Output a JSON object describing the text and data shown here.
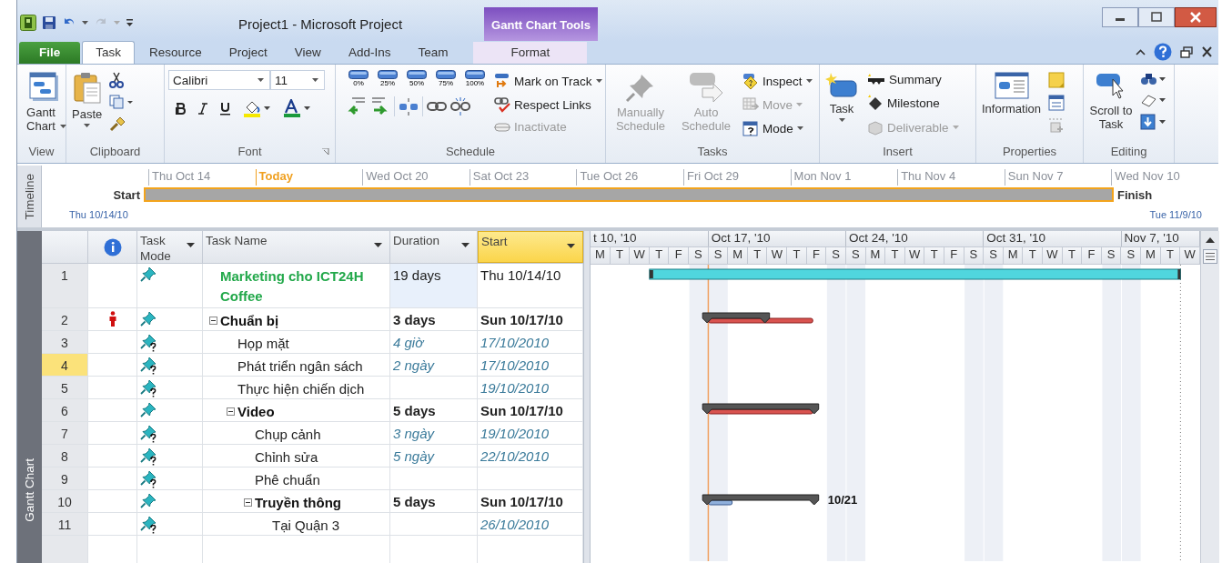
{
  "window": {
    "title": "Project1  -  Microsoft Project"
  },
  "contextual_tab": {
    "title": "Gantt Chart Tools"
  },
  "tabs": [
    {
      "label": "File",
      "kind": "file",
      "selected": false
    },
    {
      "label": "Task",
      "kind": "normal",
      "selected": true
    },
    {
      "label": "Resource",
      "kind": "normal",
      "selected": false
    },
    {
      "label": "Project",
      "kind": "normal",
      "selected": false
    },
    {
      "label": "View",
      "kind": "normal",
      "selected": false
    },
    {
      "label": "Add-Ins",
      "kind": "normal",
      "selected": false
    },
    {
      "label": "Team",
      "kind": "normal",
      "selected": false
    },
    {
      "label": "Format",
      "kind": "contextual",
      "selected": false
    }
  ],
  "ribbon": {
    "groups": [
      {
        "label": "View",
        "buttons": [
          {
            "label": "Gantt Chart",
            "disabled": false
          }
        ]
      },
      {
        "label": "Clipboard",
        "buttons": [
          {
            "label": "Paste",
            "disabled": false
          }
        ]
      },
      {
        "label": "Font",
        "font_name": "Calibri",
        "font_size": "11"
      },
      {
        "label": "Schedule",
        "percent_buttons": [
          "0%",
          "25%",
          "50%",
          "75%",
          "100%"
        ],
        "buttons": [
          {
            "label": "Mark on Track",
            "disabled": false
          },
          {
            "label": "Respect Links",
            "disabled": false
          },
          {
            "label": "Inactivate",
            "disabled": true
          }
        ]
      },
      {
        "label": "Tasks",
        "buttons": [
          {
            "label": "Manually Schedule",
            "disabled": true
          },
          {
            "label": "Auto Schedule",
            "disabled": true
          },
          {
            "label": "Inspect",
            "disabled": false
          },
          {
            "label": "Move",
            "disabled": true
          },
          {
            "label": "Mode",
            "disabled": false
          }
        ]
      },
      {
        "label": "Insert",
        "buttons": [
          {
            "label": "Task",
            "disabled": false
          },
          {
            "label": "Summary",
            "disabled": false
          },
          {
            "label": "Milestone",
            "disabled": false
          },
          {
            "label": "Deliverable",
            "disabled": true
          }
        ]
      },
      {
        "label": "Properties",
        "buttons": [
          {
            "label": "Information",
            "disabled": false
          }
        ]
      },
      {
        "label": "Editing",
        "buttons": [
          {
            "label": "Scroll to Task",
            "disabled": false
          }
        ]
      }
    ]
  },
  "timeline": {
    "label": "Timeline",
    "ticks": [
      {
        "label": "Thu Oct 14",
        "kind": "date"
      },
      {
        "label": "Today",
        "kind": "today"
      },
      {
        "label": "Wed Oct 20",
        "kind": "date"
      },
      {
        "label": "Sat Oct 23",
        "kind": "date"
      },
      {
        "label": "Tue Oct 26",
        "kind": "date"
      },
      {
        "label": "Fri Oct 29",
        "kind": "date"
      },
      {
        "label": "Mon Nov 1",
        "kind": "date"
      },
      {
        "label": "Thu Nov 4",
        "kind": "date"
      },
      {
        "label": "Sun Nov 7",
        "kind": "date"
      },
      {
        "label": "Wed Nov 10",
        "kind": "date"
      }
    ],
    "start_label": "Start",
    "start_date": "Thu 10/14/10",
    "finish_label": "Finish",
    "finish_date": "Tue 11/9/10"
  },
  "view_label": "Gantt Chart",
  "table": {
    "columns": [
      {
        "kind": "indicators",
        "selected": false
      },
      {
        "label": "Task Mode",
        "kind": "text",
        "selected": false
      },
      {
        "label": "Task Name",
        "kind": "text",
        "selected": false
      },
      {
        "label": "Duration",
        "kind": "text",
        "selected": false
      },
      {
        "label": "Start",
        "kind": "text",
        "selected": true
      }
    ],
    "rows": [
      {
        "id": "1",
        "name": "Marketing cho ICT24H Coffee",
        "kind": "project",
        "flagged": false,
        "estimated": false,
        "duration": "19 days",
        "start": "Thu 10/14/10",
        "selected": false,
        "duration_focused": true
      },
      {
        "id": "2",
        "name": "Chuẩn bị",
        "kind": "summary",
        "expanded": true,
        "flagged": true,
        "estimated": false,
        "duration": "3 days",
        "start": "Sun 10/17/10",
        "selected": false,
        "duration_focused": false,
        "children": [
          {
            "id": "3",
            "name": "Họp mặt",
            "kind": "task",
            "flagged": false,
            "estimated": true,
            "duration": "4 giờ",
            "start": "17/10/2010",
            "selected": false,
            "duration_focused": false
          },
          {
            "id": "4",
            "name": "Phát triển ngân sách",
            "kind": "task",
            "flagged": false,
            "estimated": true,
            "duration": "2 ngày",
            "start": "17/10/2010",
            "selected": true,
            "duration_focused": false
          },
          {
            "id": "5",
            "name": "Thực hiện chiến dịch",
            "kind": "task",
            "flagged": false,
            "estimated": true,
            "start": "19/10/2010",
            "selected": false,
            "duration_focused": false
          },
          {
            "id": "6",
            "name": "Video",
            "kind": "summary",
            "expanded": true,
            "flagged": false,
            "estimated": false,
            "duration": "5 days",
            "start": "Sun 10/17/10",
            "selected": false,
            "duration_focused": false,
            "children": [
              {
                "id": "7",
                "name": "Chụp cảnh",
                "kind": "task",
                "flagged": false,
                "estimated": true,
                "duration": "3 ngày",
                "start": "19/10/2010",
                "selected": false,
                "duration_focused": false
              },
              {
                "id": "8",
                "name": "Chỉnh sửa",
                "kind": "task",
                "flagged": false,
                "estimated": true,
                "duration": "5 ngày",
                "start": "22/10/2010",
                "selected": false,
                "duration_focused": false
              },
              {
                "id": "9",
                "name": "Phê chuẩn",
                "kind": "task",
                "flagged": false,
                "estimated": true,
                "selected": false,
                "duration_focused": false
              },
              {
                "id": "10",
                "name": "Truyền thông",
                "kind": "summary",
                "expanded": true,
                "flagged": false,
                "estimated": false,
                "duration": "5 days",
                "start": "Sun 10/17/10",
                "selected": false,
                "duration_focused": false,
                "bar_label": "10/21",
                "children": [
                  {
                    "id": "11",
                    "name": "Tại Quận 3",
                    "kind": "task",
                    "flagged": false,
                    "estimated": true,
                    "start": "26/10/2010",
                    "selected": false,
                    "duration_focused": false
                  }
                ]
              }
            ]
          }
        ]
      }
    ]
  },
  "gantt": {
    "weeks": [
      {
        "label": "t 10, '10",
        "days": [
          "M",
          "T",
          "W",
          "T",
          "F",
          "S"
        ]
      },
      {
        "label": "Oct 17, '10",
        "days": [
          "S",
          "M",
          "T",
          "W",
          "T",
          "F",
          "S"
        ]
      },
      {
        "label": "Oct 24, '10",
        "days": [
          "S",
          "M",
          "T",
          "W",
          "T",
          "F",
          "S"
        ]
      },
      {
        "label": "Oct 31, '10",
        "days": [
          "S",
          "M",
          "T",
          "W",
          "T",
          "F",
          "S"
        ]
      },
      {
        "label": "Nov 7, '10",
        "days": [
          "S",
          "M",
          "T",
          "W"
        ]
      }
    ]
  }
}
